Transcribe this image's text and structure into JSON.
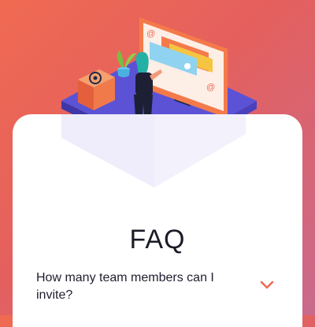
{
  "faq": {
    "title": "FAQ",
    "items": [
      {
        "question": "How many team members can I invite?",
        "expanded": false
      }
    ]
  },
  "colors": {
    "background_start": "#f06a52",
    "background_end": "#c96a8c",
    "accent": "#f06a52",
    "platform": "#5b52d6",
    "card": "#ffffff",
    "text": "#1a1b26"
  },
  "icons": [
    "at-sign-icon",
    "chevron-down-icon",
    "plant-icon",
    "monitor-icon"
  ]
}
